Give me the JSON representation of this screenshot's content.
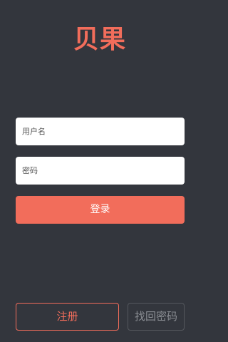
{
  "app": {
    "logo_text": "贝果"
  },
  "form": {
    "username_placeholder": "用户名",
    "password_placeholder": "密码",
    "login_label": "登录"
  },
  "footer": {
    "register_label": "注册",
    "forgot_label": "找回密码"
  },
  "colors": {
    "background": "#33363d",
    "accent": "#f26d5b",
    "input_bg": "#ffffff",
    "muted_border": "#55585e"
  }
}
